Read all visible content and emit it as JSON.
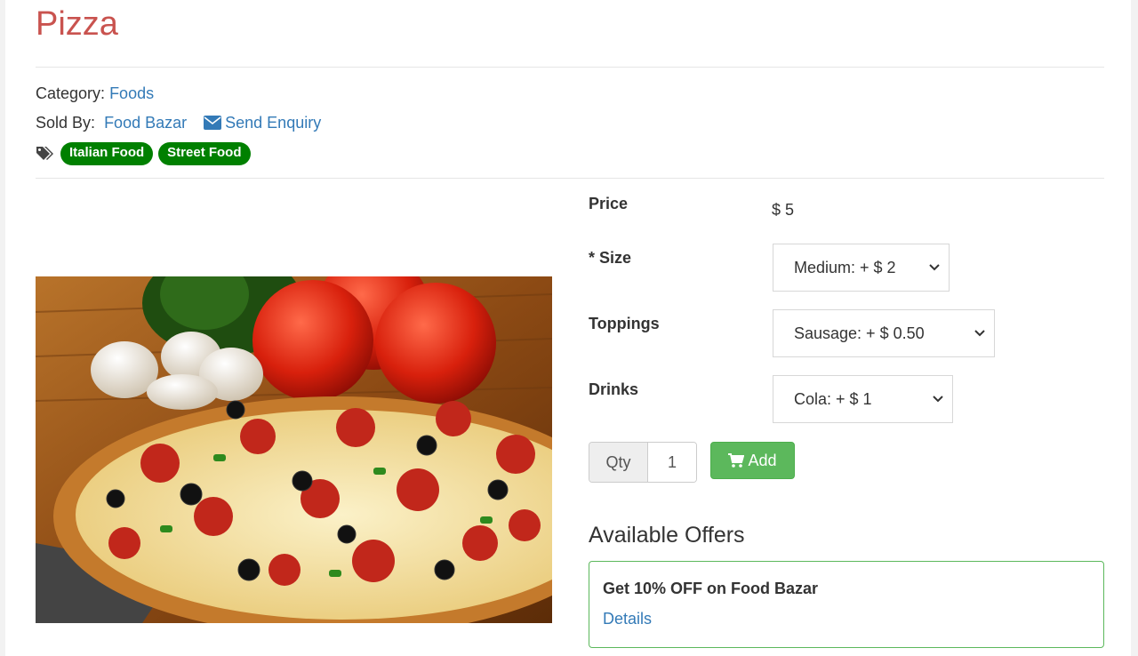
{
  "product": {
    "title": "Pizza",
    "category_label": "Category:",
    "category_value": "Foods",
    "sold_by_label": "Sold By:",
    "seller": "Food Bazar",
    "enquiry": "Send Enquiry",
    "tags": [
      "Italian Food",
      "Street Food"
    ]
  },
  "options": {
    "price_label": "Price",
    "price_value": "$ 5",
    "size_label": "* Size",
    "size_value": "Medium: + $ 2",
    "toppings_label": "Toppings",
    "toppings_value": "Sausage: + $ 0.50",
    "drinks_label": "Drinks",
    "drinks_value": "Cola: + $ 1"
  },
  "cart": {
    "qty_label": "Qty",
    "qty_value": "1",
    "add_label": "Add"
  },
  "offers": {
    "heading": "Available Offers",
    "items": [
      {
        "title": "Get 10% OFF on Food Bazar",
        "link": "Details"
      }
    ]
  },
  "colors": {
    "title": "#c9534f",
    "link": "#337ab7",
    "tag_bg": "#008000",
    "add_button": "#5cb85c",
    "offer_border": "#5cb85c"
  },
  "icons": [
    "envelope-icon",
    "tags-icon",
    "cart-icon",
    "chevron-down-icon"
  ]
}
